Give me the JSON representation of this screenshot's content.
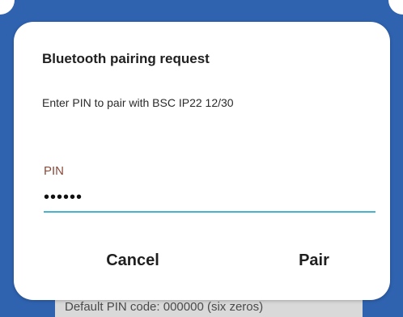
{
  "dialog": {
    "title": "Bluetooth pairing request",
    "message": "Enter PIN to pair with BSC IP22 12/30",
    "pin_label": "PIN",
    "pin_value": "000000",
    "cancel_label": "Cancel",
    "pair_label": "Pair"
  },
  "background": {
    "footer_text": "Default PIN code: 000000 (six zeros)"
  },
  "colors": {
    "backdrop": "#2f63b0",
    "input_underline": "#47b3cf",
    "pin_label": "#8a4a3a"
  }
}
